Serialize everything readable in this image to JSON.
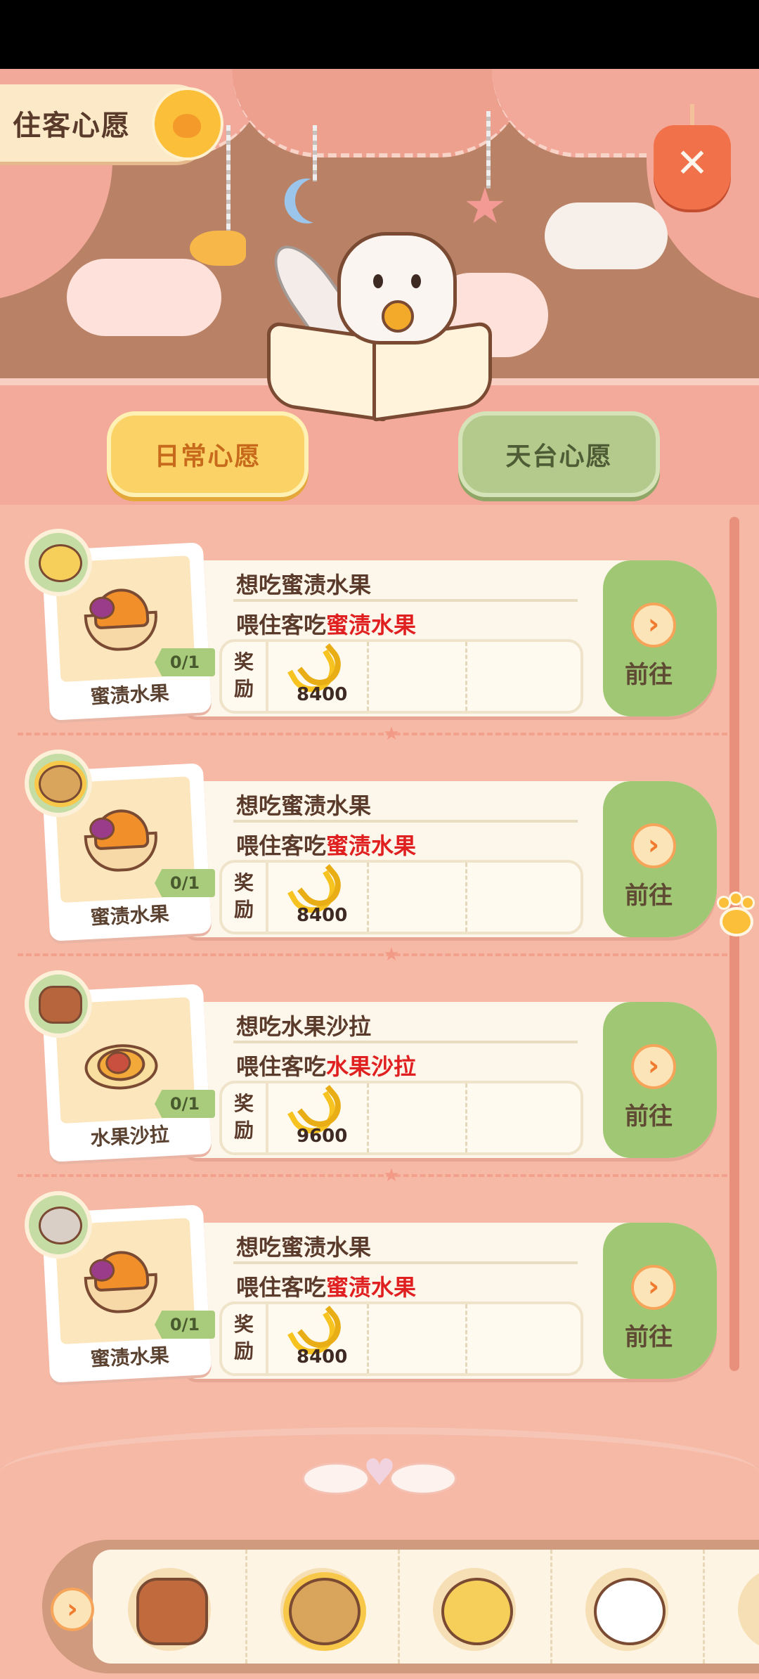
{
  "header": {
    "title": "住客心愿",
    "close_icon": "close-x-icon"
  },
  "tabs": [
    {
      "label": "日常心愿",
      "active": true
    },
    {
      "label": "天台心愿",
      "active": false
    }
  ],
  "wishes": [
    {
      "guest": "dog",
      "dish_label": "蜜渍水果",
      "progress": "0/1",
      "title": "想吃蜜渍水果",
      "desc_prefix": "喂住客吃",
      "desc_highlight": "蜜渍水果",
      "reward_label_1": "奖",
      "reward_label_2": "励",
      "reward_amount": "8400",
      "go_label": "前往"
    },
    {
      "guest": "sunflower",
      "dish_label": "蜜渍水果",
      "progress": "0/1",
      "title": "想吃蜜渍水果",
      "desc_prefix": "喂住客吃",
      "desc_highlight": "蜜渍水果",
      "reward_label_1": "奖",
      "reward_label_2": "励",
      "reward_amount": "8400",
      "go_label": "前往"
    },
    {
      "guest": "burger",
      "dish_label": "水果沙拉",
      "progress": "0/1",
      "title": "想吃水果沙拉",
      "desc_prefix": "喂住客吃",
      "desc_highlight": "水果沙拉",
      "reward_label_1": "奖",
      "reward_label_2": "励",
      "reward_amount": "9600",
      "go_label": "前往"
    },
    {
      "guest": "mouse",
      "dish_label": "蜜渍水果",
      "progress": "0/1",
      "title": "想吃蜜渍水果",
      "desc_prefix": "喂住客吃",
      "desc_highlight": "蜜渍水果",
      "reward_label_1": "奖",
      "reward_label_2": "励",
      "reward_amount": "8400",
      "go_label": "前往"
    }
  ],
  "guest_tray": [
    "burger-guest",
    "sunflower-guest",
    "dog-guest",
    "mouse-guest"
  ],
  "colors": {
    "background": "#f6b9a6",
    "go_button": "#9fc774",
    "highlight": "#e02020",
    "active_tab": "#fbd265",
    "inactive_tab": "#b4c98c"
  }
}
